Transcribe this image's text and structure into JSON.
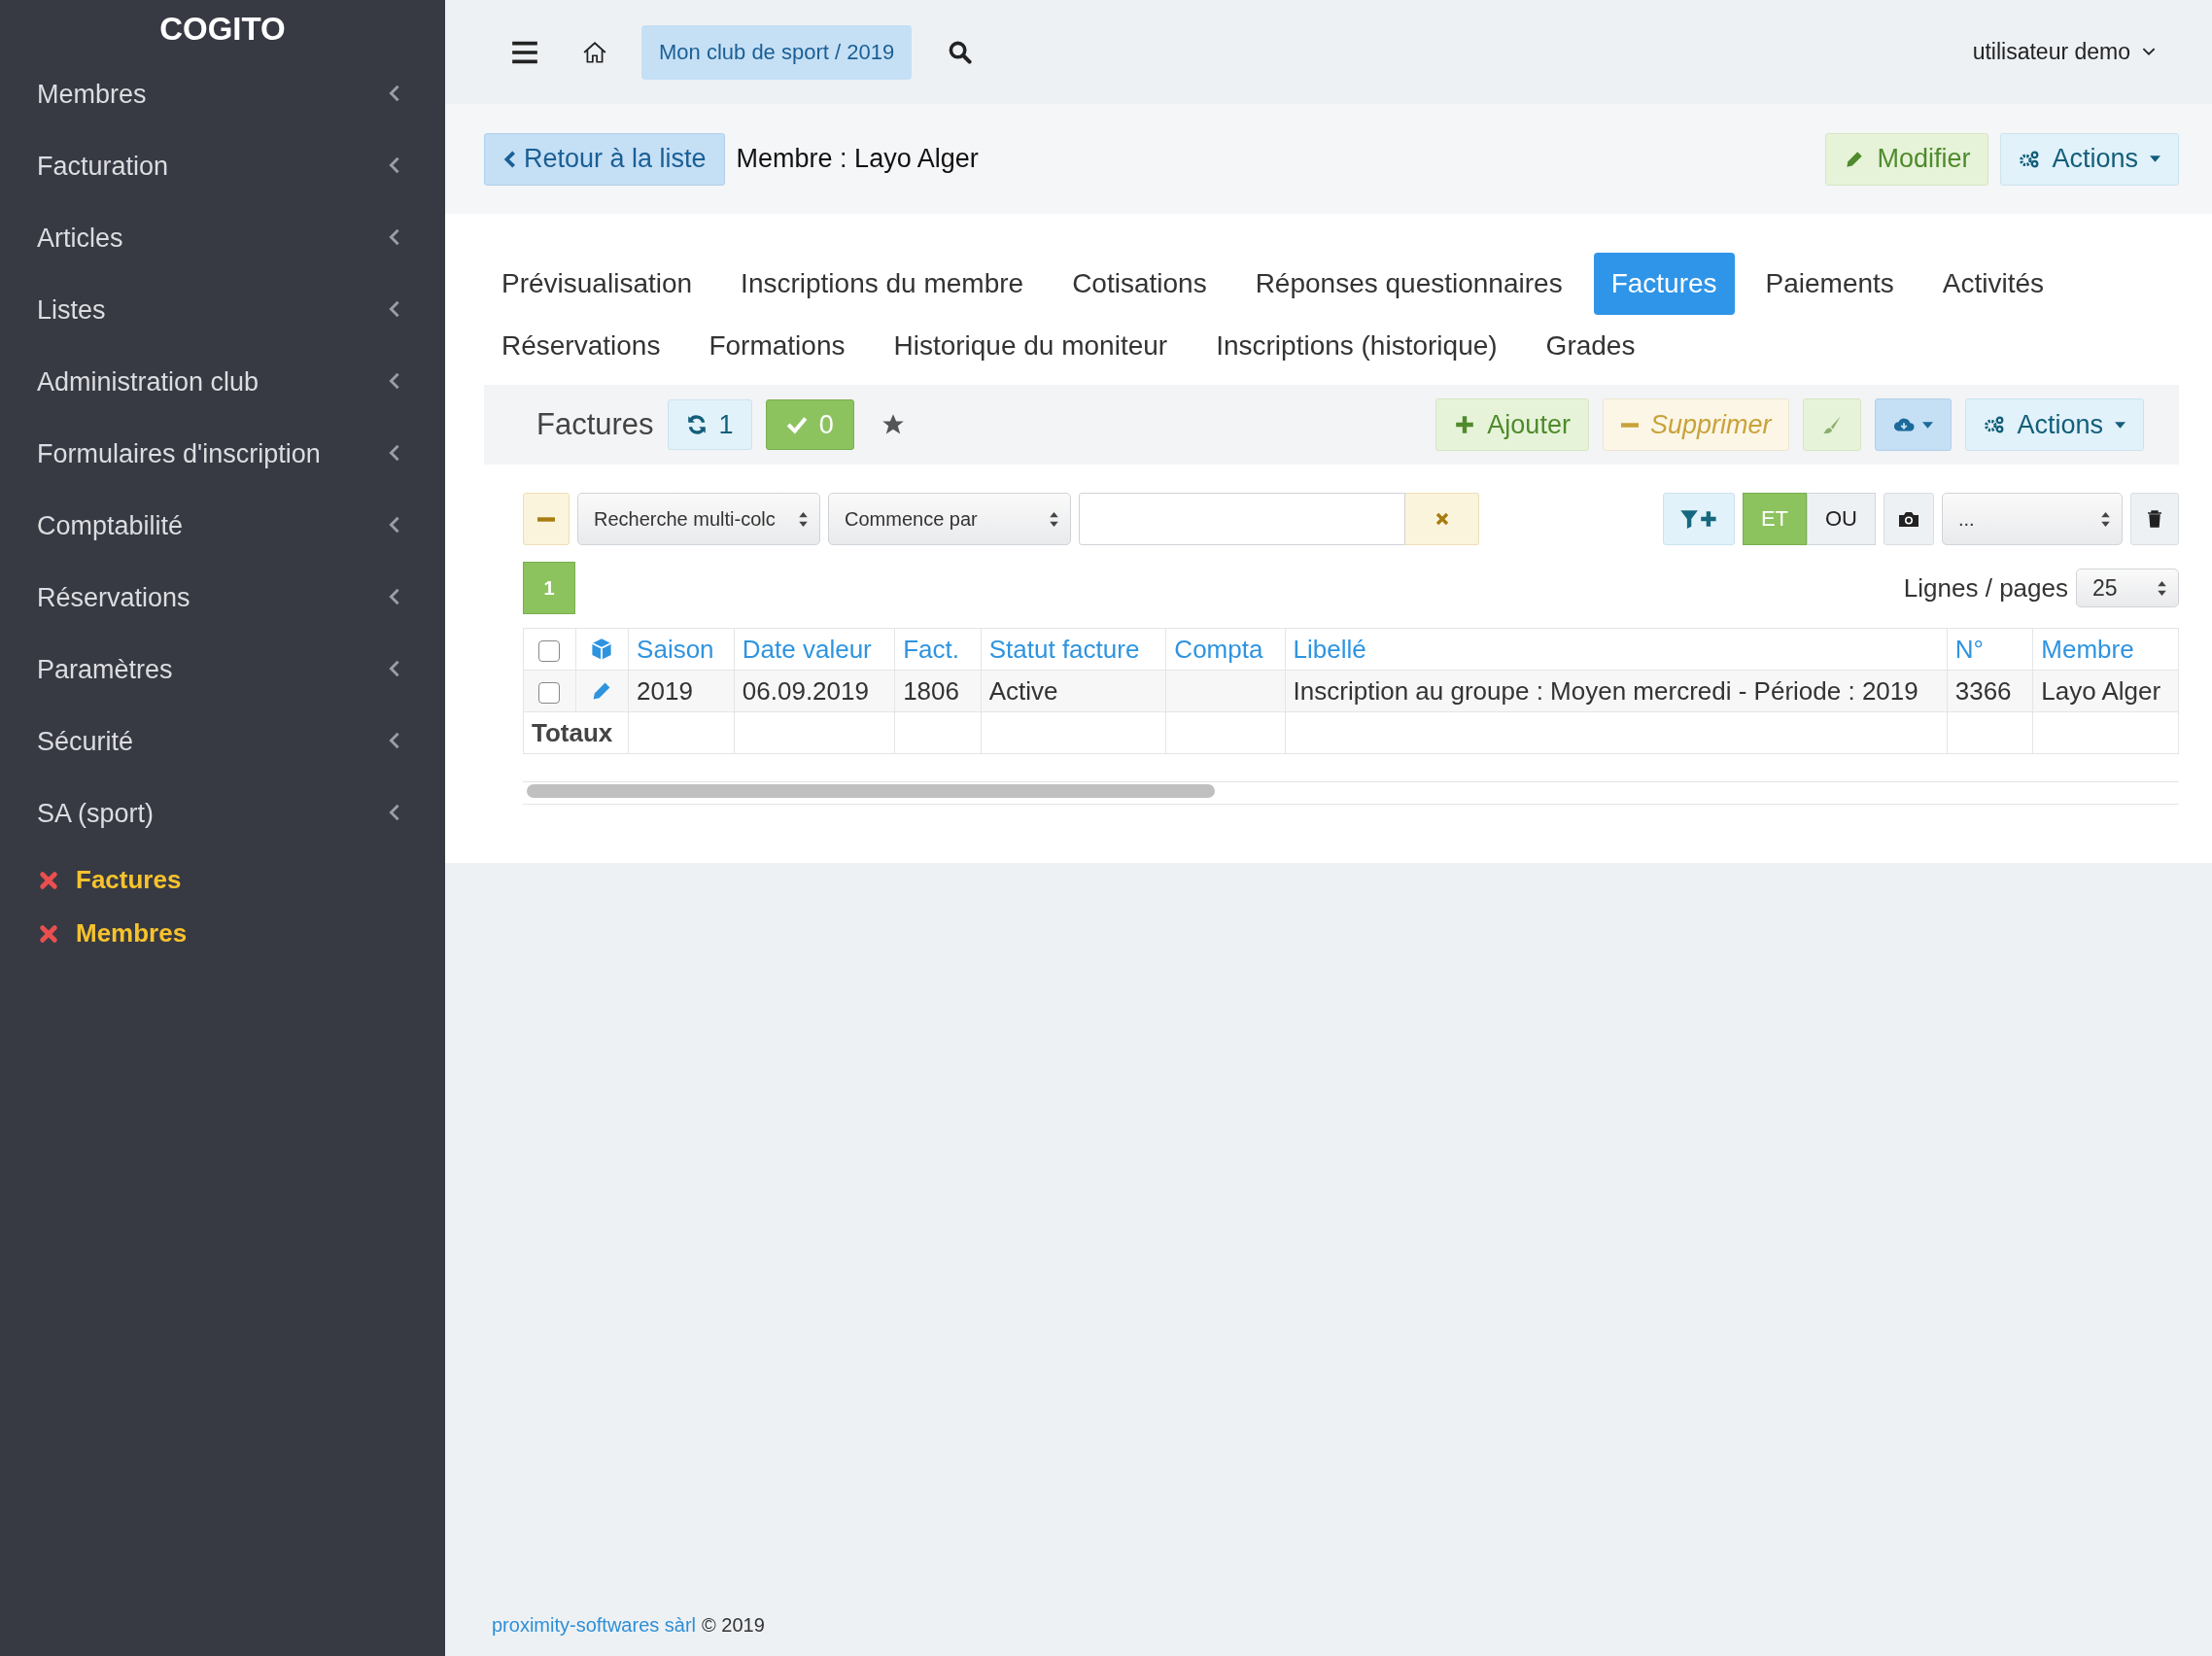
{
  "sidebar": {
    "brand": "COGITO",
    "items": [
      {
        "label": "Membres"
      },
      {
        "label": "Facturation"
      },
      {
        "label": "Articles"
      },
      {
        "label": "Listes"
      },
      {
        "label": "Administration club"
      },
      {
        "label": "Formulaires d'inscription"
      },
      {
        "label": "Comptabilité"
      },
      {
        "label": "Réservations"
      },
      {
        "label": "Paramètres"
      },
      {
        "label": "Sécurité"
      },
      {
        "label": "SA (sport)"
      }
    ],
    "favorites": [
      {
        "label": "Factures"
      },
      {
        "label": "Membres"
      }
    ]
  },
  "topbar": {
    "club": "Mon club de sport / 2019",
    "user": "utilisateur demo"
  },
  "header": {
    "back_button": "Retour à la liste",
    "title": "Membre : Layo Alger",
    "buttons": [
      {
        "kind": "edit",
        "label": "Modifier"
      },
      {
        "kind": "actions",
        "label": "Actions"
      }
    ]
  },
  "tab_rows": [
    {
      "tabs": [
        {
          "label": "Prévisualisation",
          "selected": false
        },
        {
          "label": "Inscriptions du membre",
          "selected": false
        },
        {
          "label": "Cotisations",
          "selected": false
        },
        {
          "label": "Réponses questionnaires",
          "selected": false
        },
        {
          "label": "Factures",
          "selected": true
        },
        {
          "label": "Paiements",
          "selected": false
        },
        {
          "label": "Activités",
          "selected": false
        }
      ]
    },
    {
      "tabs": [
        {
          "label": "Réservations",
          "selected": false
        },
        {
          "label": "Formations",
          "selected": false
        },
        {
          "label": "Historique du moniteur",
          "selected": false
        },
        {
          "label": "Inscriptions (historique)",
          "selected": false
        },
        {
          "label": "Grades",
          "selected": false
        }
      ]
    }
  ],
  "toolbar": {
    "title": "Factures",
    "refresh_count": "1",
    "check_count": "0",
    "buttons": [
      {
        "kind": "add",
        "label": "Ajouter"
      },
      {
        "kind": "delete",
        "label": "Supprimer"
      },
      {
        "kind": "brush"
      },
      {
        "kind": "download"
      },
      {
        "kind": "actions",
        "label": "Actions"
      }
    ]
  },
  "filter": {
    "field_select": "Recherche multi-colc",
    "mode_select": "Commence par",
    "logic": [
      {
        "label": "ET",
        "selected": true
      },
      {
        "label": "OU",
        "selected": false
      }
    ],
    "saved_select": "..."
  },
  "pages": [
    {
      "label": "1",
      "selected": true
    }
  ],
  "page_size": {
    "label": "Lignes / pages",
    "value": "25"
  },
  "table": {
    "header_checked": false,
    "columns": [
      "Saison",
      "Date valeur",
      "Fact.",
      "Statut facture",
      "Compta",
      "Libellé",
      "N°",
      "Membre"
    ],
    "rows": [
      {
        "checked": false,
        "cells": [
          "2019",
          "06.09.2019",
          "1806",
          "Active",
          "",
          "Inscription au groupe : Moyen mercredi - Période : 2019",
          "3366",
          "Layo Alger"
        ]
      }
    ],
    "totals_label": "Totaux"
  },
  "footer": {
    "link": "proximity-softwares sàrl",
    "text": "© 2019"
  }
}
